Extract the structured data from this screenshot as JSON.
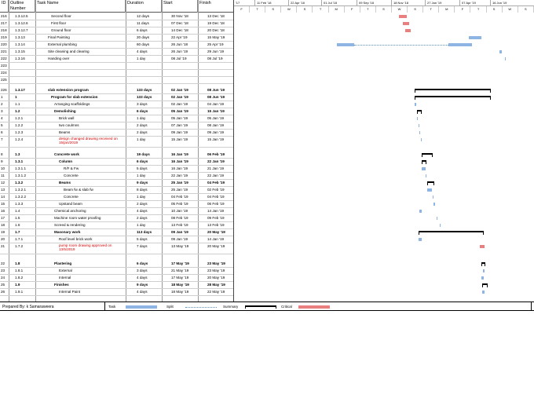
{
  "columns": {
    "id": "ID",
    "outline": "Outline Number",
    "name": "Task Name",
    "duration": "Duration",
    "start": "Start",
    "finish": "Finish"
  },
  "timeline": {
    "top": [
      "'17",
      "11 Feb '18",
      "22 Apr '18",
      "01 Jul '18",
      "09 Sep '18",
      "18 Nov '18",
      "27 Jan '19",
      "07 Apr '19",
      "16 Jun '19"
    ],
    "bottom": [
      "F",
      "T",
      "S",
      "W",
      "S",
      "T",
      "M",
      "F",
      "T",
      "S",
      "W",
      "S",
      "T",
      "M",
      "F",
      "T",
      "S",
      "W",
      "S"
    ]
  },
  "rows": [
    {
      "id": "216",
      "outline": "1.3.12.5",
      "name": "Second floor",
      "duration": "12 days",
      "start": "30 Nov '18",
      "finish": "13 Dec '18",
      "bold": false,
      "indent": 10
    },
    {
      "id": "217",
      "outline": "1.3.12.6",
      "name": "First floor",
      "duration": "11 days",
      "start": "07 Dec '18",
      "finish": "19 Dec '18",
      "bold": false,
      "indent": 10
    },
    {
      "id": "218",
      "outline": "1.3.12.7",
      "name": "Ground floor",
      "duration": "6 days",
      "start": "14 Dec '18",
      "finish": "20 Dec '18",
      "bold": false,
      "indent": 10
    },
    {
      "id": "219",
      "outline": "1.3.13",
      "name": "Final Painting",
      "duration": "20 days",
      "start": "22 Apr '19",
      "finish": "15 May '19",
      "bold": false,
      "indent": 6
    },
    {
      "id": "220",
      "outline": "1.3.14",
      "name": "External plumbing",
      "duration": "60 days",
      "start": "26 Jun '18",
      "finish": "25 Apr '19",
      "bold": false,
      "indent": 6
    },
    {
      "id": "221",
      "outline": "1.3.15",
      "name": "Site cleaning and clearing",
      "duration": "4 days",
      "start": "26 Jun '19",
      "finish": "29 Jun '19",
      "bold": false,
      "indent": 6
    },
    {
      "id": "222",
      "outline": "1.3.16",
      "name": "Handing over",
      "duration": "1 day",
      "start": "08 Jul '19",
      "finish": "08 Jul '19",
      "bold": false,
      "indent": 6
    },
    {
      "id": "223",
      "outline": "",
      "name": "",
      "duration": "",
      "start": "",
      "finish": "",
      "bold": false,
      "indent": 0
    },
    {
      "id": "224",
      "outline": "",
      "name": "",
      "duration": "",
      "start": "",
      "finish": "",
      "bold": false,
      "indent": 0
    },
    {
      "id": "225",
      "outline": "",
      "name": "",
      "duration": "",
      "start": "",
      "finish": "",
      "bold": false,
      "indent": 0
    },
    {
      "id": "226",
      "outline": "1.3.17",
      "name": "slab extension program",
      "duration": "133 days",
      "start": "02 Jan '19",
      "finish": "08 Jun '19",
      "bold": true,
      "indent": 6
    },
    {
      "id": "1",
      "outline": "1",
      "name": "Program for slab extension",
      "duration": "133 days",
      "start": "02 Jan '19",
      "finish": "08 Jun '19",
      "bold": true,
      "indent": 10
    },
    {
      "id": "2",
      "outline": "1.1",
      "name": "Arranging scaffoldings",
      "duration": "3 days",
      "start": "02 Jan '19",
      "finish": "04 Jan '19",
      "bold": false,
      "indent": 14
    },
    {
      "id": "3",
      "outline": "1.2",
      "name": "Demolishing",
      "duration": "6 days",
      "start": "05 Jan '19",
      "finish": "15 Jan '19",
      "bold": true,
      "indent": 14
    },
    {
      "id": "4",
      "outline": "1.2.1",
      "name": "Brick wall",
      "duration": "1 day",
      "start": "05 Jan '19",
      "finish": "05 Jan '19",
      "bold": false,
      "indent": 20
    },
    {
      "id": "5",
      "outline": "1.2.2",
      "name": "two coulmns",
      "duration": "2 days",
      "start": "07 Jan '19",
      "finish": "08 Jan '19",
      "bold": false,
      "indent": 20
    },
    {
      "id": "6",
      "outline": "1.2.3",
      "name": "Beams",
      "duration": "2 days",
      "start": "09 Jan '19",
      "finish": "09 Jan '19",
      "bold": false,
      "indent": 20
    },
    {
      "id": "7",
      "outline": "1.2.4",
      "name": "design changed drawing received on 15/jan/2019",
      "duration": "1 day",
      "start": "15 Jan '19",
      "finish": "15 Jan '19",
      "bold": false,
      "indent": 20,
      "red": true,
      "tall": true
    },
    {
      "id": "8",
      "outline": "1.3",
      "name": "Concrete work",
      "duration": "19 days",
      "start": "16 Jan '19",
      "finish": "06 Feb '19",
      "bold": true,
      "indent": 14
    },
    {
      "id": "9",
      "outline": "1.3.1",
      "name": "Column",
      "duration": "6 days",
      "start": "16 Jan '19",
      "finish": "22 Jan '19",
      "bold": true,
      "indent": 20
    },
    {
      "id": "10",
      "outline": "1.3.1.1",
      "name": "R/F & Fw",
      "duration": "5 days",
      "start": "16 Jan '19",
      "finish": "21 Jan '19",
      "bold": false,
      "indent": 26
    },
    {
      "id": "11",
      "outline": "1.3.1.2",
      "name": "Concrete",
      "duration": "1 day",
      "start": "22 Jan '19",
      "finish": "22 Jan '19",
      "bold": false,
      "indent": 26
    },
    {
      "id": "12",
      "outline": "1.3.2",
      "name": "Beams",
      "duration": "9 days",
      "start": "25 Jan '19",
      "finish": "04 Feb '19",
      "bold": true,
      "indent": 20
    },
    {
      "id": "13",
      "outline": "1.3.2.1",
      "name": "Beam fw & slab fw",
      "duration": "8 days",
      "start": "25 Jan '19",
      "finish": "02 Feb '19",
      "bold": false,
      "indent": 26
    },
    {
      "id": "14",
      "outline": "1.3.2.2",
      "name": "Concrete",
      "duration": "1 day",
      "start": "04 Feb '19",
      "finish": "04 Feb '19",
      "bold": false,
      "indent": 26
    },
    {
      "id": "15",
      "outline": "1.3.3",
      "name": "Upstand beam",
      "duration": "2 days",
      "start": "05 Feb '19",
      "finish": "06 Feb '19",
      "bold": false,
      "indent": 20
    },
    {
      "id": "16",
      "outline": "1.4",
      "name": "Chemical anchoring",
      "duration": "4 days",
      "start": "10 Jan '19",
      "finish": "14 Jan '19",
      "bold": false,
      "indent": 14
    },
    {
      "id": "17",
      "outline": "1.5",
      "name": "Machine room water proofing",
      "duration": "2 days",
      "start": "08 Feb '19",
      "finish": "09 Feb '19",
      "bold": false,
      "indent": 14
    },
    {
      "id": "18",
      "outline": "1.6",
      "name": "Screed & rendering",
      "duration": "1 day",
      "start": "13 Feb '19",
      "finish": "13 Feb '19",
      "bold": false,
      "indent": 14
    },
    {
      "id": "19",
      "outline": "1.7",
      "name": "Masonary work",
      "duration": "113 days",
      "start": "09 Jan '19",
      "finish": "20 May '19",
      "bold": true,
      "indent": 14
    },
    {
      "id": "20",
      "outline": "1.7.1",
      "name": "Roof level brick work",
      "duration": "5 days",
      "start": "09 Jan '19",
      "finish": "14 Jan '19",
      "bold": false,
      "indent": 20
    },
    {
      "id": "21",
      "outline": "1.7.2",
      "name": "pump room drawing approved on 13/5/2019",
      "duration": "7 days",
      "start": "13 May '19",
      "finish": "20 May '19",
      "bold": false,
      "indent": 20,
      "red": true,
      "tall": true
    },
    {
      "id": "22",
      "outline": "1.8",
      "name": "Plastering",
      "duration": "6 days",
      "start": "17 May '19",
      "finish": "23 May '19",
      "bold": true,
      "indent": 14
    },
    {
      "id": "23",
      "outline": "1.8.1",
      "name": "External",
      "duration": "3 days",
      "start": "21 May '19",
      "finish": "23 May '19",
      "bold": false,
      "indent": 20
    },
    {
      "id": "24",
      "outline": "1.8.2",
      "name": "Internal",
      "duration": "4 days",
      "start": "17 May '19",
      "finish": "20 May '19",
      "bold": false,
      "indent": 20
    },
    {
      "id": "25",
      "outline": "1.9",
      "name": "Finishes",
      "duration": "9 days",
      "start": "18 May '19",
      "finish": "28 May '19",
      "bold": true,
      "indent": 14
    },
    {
      "id": "26",
      "outline": "1.9.1",
      "name": "Internal Paint",
      "duration": "4 days",
      "start": "18 May '19",
      "finish": "22 May '19",
      "bold": false,
      "indent": 20
    }
  ],
  "footer": {
    "prepared": "Prepared By: k Samaraweera",
    "legend_task": "Task",
    "legend_split": "Split",
    "legend_summary": "Summary",
    "legend_critical": "Critical"
  },
  "colors": {
    "task": "#8db4e2",
    "critical": "#e88080",
    "summary": "#000000"
  }
}
